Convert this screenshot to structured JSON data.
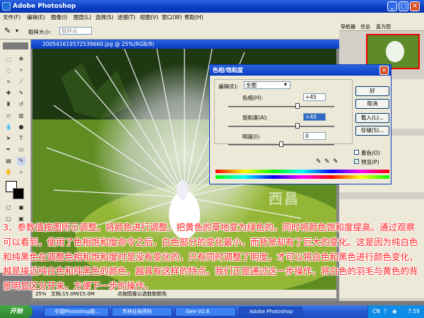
{
  "window": {
    "title": "Adobe Photoshop"
  },
  "menu": [
    "文件(F)",
    "编辑(E)",
    "图像(I)",
    "图层(L)",
    "选择(S)",
    "滤镜(T)",
    "视图(V)",
    "窗口(W)",
    "帮助(H)"
  ],
  "options": {
    "sample_size_label": "取样大小:",
    "sample_size_value": "取样点"
  },
  "document": {
    "title": "200541619572539660.jpg @ 25%(RGB/8)",
    "zoom": "25%",
    "doc_size": "文档:15.0M/15.0M",
    "hint": "点按图像以选取新颜色"
  },
  "panels": {
    "tabs": [
      "导航器",
      "信息",
      "直方图"
    ]
  },
  "dialog": {
    "title": "色相/饱和度",
    "edit_label": "编辑(E):",
    "edit_value": "全图",
    "hue_label": "色相(H):",
    "hue_value": "+45",
    "sat_label": "饱和度(A):",
    "sat_value": "+49",
    "light_label": "明度(I):",
    "light_value": "0",
    "ok": "好",
    "cancel": "取消",
    "load": "载入(L)...",
    "save": "存储(S)...",
    "colorize": "着色(O)",
    "preview": "预览(P)"
  },
  "caption": "3、参数值按图所示调整。将颜色进行调整，把黄色的草地变为绿色的。同时将颜色饱和度提高。通过观察可以看到，使用了色相饱和度命令之后，白色部分的变化最小，而背景却有了巨大的变化。这是因为纯白色和纯黑色在调整色相和饱和度时是没有变化的，只有同时调整了明度，才可以将白色和黑色进行颜色变化，越是接近纯白色和纯黑色的颜色，越具有这样的特点。我们正是通过这一步操作，将白色的羽毛与黄色的背景明显区分开来。方便下一步的操作。",
  "watermark": "西昌",
  "taskbar": {
    "start": "开始",
    "tasks": [
      "中国Photoshop联...",
      "市林业局资料",
      "iSee V2.8",
      "Adobe Photoshop"
    ],
    "lang": "CN",
    "clock": "7:59"
  }
}
